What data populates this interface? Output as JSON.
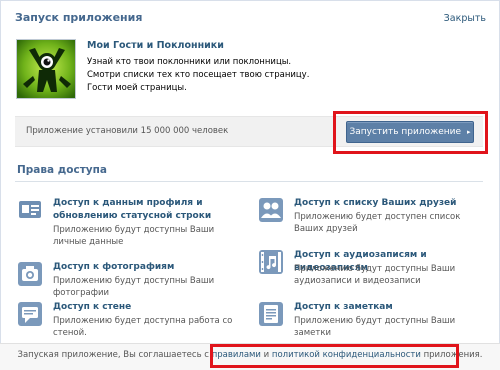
{
  "header": {
    "title": "Запуск приложения",
    "close_label": "Закрыть"
  },
  "app": {
    "name": "Мои Гости и Поклонники",
    "description_lines": [
      "Узнай кто твои поклонники или поклонницы.",
      "Смотри списки тех кто посещает твою страницу.",
      "Гости моей страницы."
    ]
  },
  "install": {
    "text": "Приложение установили 15 000 000 человек"
  },
  "launch_button": {
    "label": "Запустить приложение",
    "arrow": "▸"
  },
  "permissions": {
    "title": "Права доступа",
    "items": [
      {
        "icon": "profile-card-icon",
        "title": "Доступ к данным профиля и обновлению статусной строки",
        "desc": "Приложению будут доступны Ваши личные данные"
      },
      {
        "icon": "friends-icon",
        "title": "Доступ к списку Ваших друзей",
        "desc": "Приложению будет доступен список Ваших друзей"
      },
      {
        "icon": "camera-icon",
        "title": "Доступ к фотографиям",
        "desc": "Приложению будут доступны Ваши фотографии"
      },
      {
        "icon": "media-icon",
        "title": "Доступ к аудиозаписям и видеозаписям",
        "desc": "Приложению будут доступны Ваши аудиозаписи и видеозаписи"
      },
      {
        "icon": "wall-icon",
        "title": "Доступ к стене",
        "desc": "Приложению будет доступна работа со стеной."
      },
      {
        "icon": "notes-icon",
        "title": "Доступ к заметкам",
        "desc": "Приложению будут доступны Ваши заметки"
      }
    ]
  },
  "footer": {
    "prefix": "Запуская приложение, Вы соглашаетесь с",
    "rules_link": "правилами",
    "middle": "и",
    "privacy_link": "политикой конфиденциальности",
    "suffix": "приложения."
  },
  "colors": {
    "accent": "#45688e",
    "link": "#2b587a",
    "button": "#5d80a7",
    "highlight": "#e0141b"
  }
}
